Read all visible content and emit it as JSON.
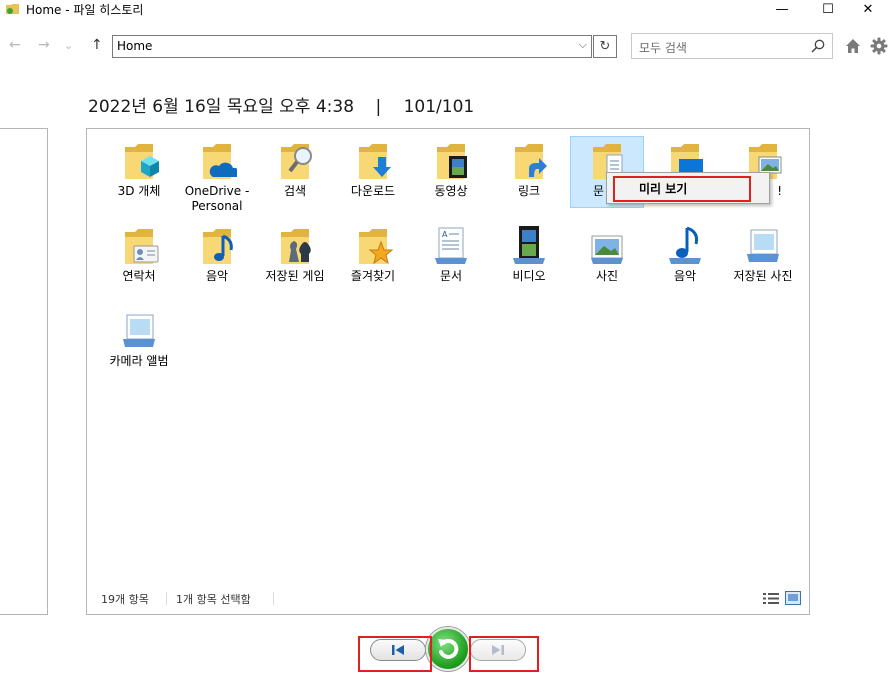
{
  "window": {
    "title": "Home - 파일 히스토리",
    "minimize_glyph": "—",
    "maximize_glyph": "☐",
    "close_glyph": "✕"
  },
  "nav": {
    "back_glyph": "←",
    "forward_glyph": "→",
    "recent_glyph": "⌄",
    "up_glyph": "↑",
    "address_value": "Home",
    "address_dropdown_glyph": "⌵",
    "refresh_glyph": "↻",
    "search_placeholder": "모두 검색"
  },
  "header": {
    "date": "2022년 6월 16일 목요일 오후 4:38",
    "separator": "|",
    "version_count": "101/101"
  },
  "items": [
    {
      "label": "3D 개체",
      "icon": "3d-objects-icon",
      "kind": "folder"
    },
    {
      "label": "OneDrive - Personal",
      "icon": "onedrive-icon",
      "kind": "folder"
    },
    {
      "label": "검색",
      "icon": "searches-icon",
      "kind": "folder"
    },
    {
      "label": "다운로드",
      "icon": "downloads-icon",
      "kind": "folder"
    },
    {
      "label": "동영상",
      "icon": "videos-icon",
      "kind": "folder"
    },
    {
      "label": "링크",
      "icon": "links-icon",
      "kind": "folder"
    },
    {
      "label": "문",
      "icon": "documents-icon",
      "kind": "folder",
      "selected": true
    },
    {
      "label": "",
      "icon": "desktop-icon",
      "kind": "folder"
    },
    {
      "label": "!",
      "icon": "pictures-icon",
      "kind": "folder"
    },
    {
      "label": "연락처",
      "icon": "contacts-icon",
      "kind": "folder"
    },
    {
      "label": "음악",
      "icon": "music-icon",
      "kind": "folder"
    },
    {
      "label": "저장된 게임",
      "icon": "saved-games-icon",
      "kind": "folder"
    },
    {
      "label": "즐겨찾기",
      "icon": "favorites-icon",
      "kind": "folder"
    },
    {
      "label": "문서",
      "icon": "documents-library-icon",
      "kind": "library"
    },
    {
      "label": "비디오",
      "icon": "videos-library-icon",
      "kind": "library"
    },
    {
      "label": "사진",
      "icon": "pictures-library-icon",
      "kind": "library"
    },
    {
      "label": "음악",
      "icon": "music-library-icon",
      "kind": "library"
    },
    {
      "label": "저장된 사진",
      "icon": "saved-pictures-icon",
      "kind": "library"
    },
    {
      "label": "카메라 앨범",
      "icon": "camera-roll-icon",
      "kind": "library"
    }
  ],
  "context_menu": {
    "preview_label": "미리 보기"
  },
  "status": {
    "item_count": "19개 항목",
    "selection": "1개 항목 선택함"
  },
  "colors": {
    "selection_bg": "#cce8ff",
    "highlight_red": "#e0201e",
    "restore_green": "#1f9f1f",
    "folder_yellow": "#f8d775"
  }
}
